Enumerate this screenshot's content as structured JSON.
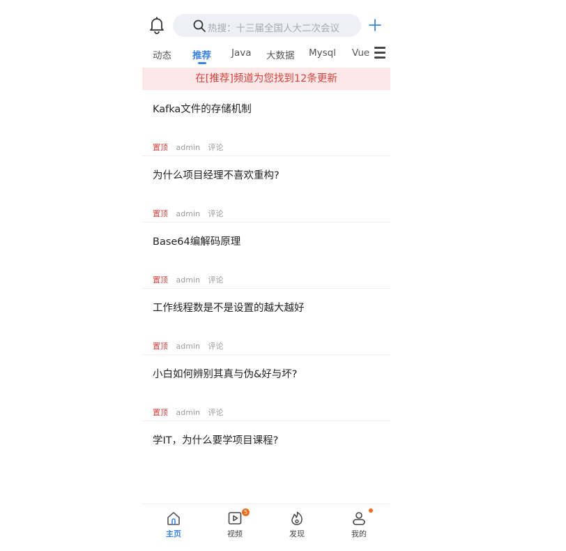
{
  "header": {
    "search_placeholder": "热搜：十三届全国人大二次会议"
  },
  "tabs": [
    {
      "label": "动态",
      "active": false
    },
    {
      "label": "推荐",
      "active": true
    },
    {
      "label": "Java",
      "active": false
    },
    {
      "label": "大数据",
      "active": false
    },
    {
      "label": "Mysql",
      "active": false
    },
    {
      "label": "Vue",
      "active": false
    }
  ],
  "banner": {
    "text": "在[推荐]频道为您找到12条更新"
  },
  "articles": [
    {
      "title": "Kafka文件的存储机制",
      "pin": "置顶",
      "author": "admin",
      "comment": "评论"
    },
    {
      "title": "为什么项目经理不喜欢重构?",
      "pin": "置顶",
      "author": "admin",
      "comment": "评论"
    },
    {
      "title": "Base64编解码原理",
      "pin": "置顶",
      "author": "admin",
      "comment": "评论"
    },
    {
      "title": "工作线程数是不是设置的越大越好",
      "pin": "置顶",
      "author": "admin",
      "comment": "评论"
    },
    {
      "title": "小白如何辨别其真与伪&好与坏?",
      "pin": "置顶",
      "author": "admin",
      "comment": "评论"
    },
    {
      "title": "学IT，为什么要学项目课程?",
      "pin": "",
      "author": "",
      "comment": ""
    }
  ],
  "bottom_nav": [
    {
      "label": "主页",
      "icon": "home-icon",
      "active": true
    },
    {
      "label": "视频",
      "icon": "video-icon",
      "badge": "5"
    },
    {
      "label": "发现",
      "icon": "fire-icon"
    },
    {
      "label": "我的",
      "icon": "user-icon",
      "dot": true
    }
  ],
  "colors": {
    "accent": "#3a82e8",
    "alert": "#d9423a",
    "badge": "#f06a1a",
    "banner_bg": "#fce8e8"
  }
}
